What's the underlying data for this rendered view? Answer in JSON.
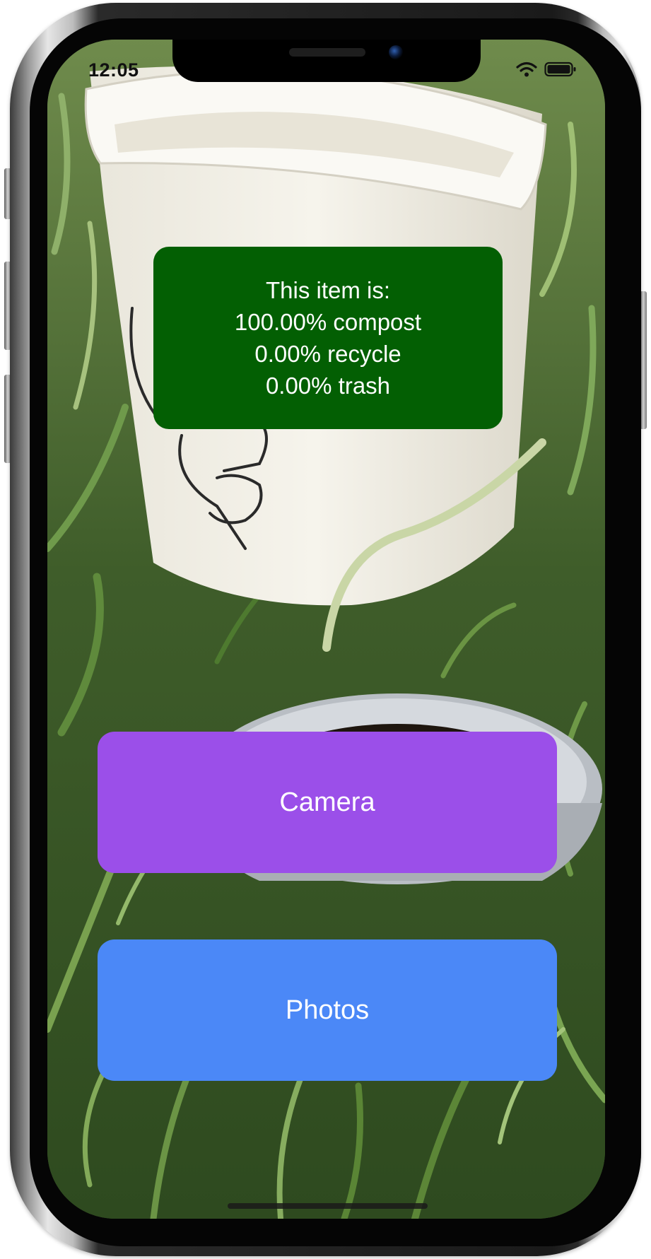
{
  "status_bar": {
    "time": "12:05",
    "icons": [
      "wifi-icon",
      "battery-icon"
    ]
  },
  "result": {
    "heading": "This item is:",
    "compost": "100.00% compost",
    "recycle": "0.00% recycle",
    "trash": "0.00% trash",
    "background_color": "#035f03"
  },
  "buttons": {
    "camera_label": "Camera",
    "photos_label": "Photos",
    "camera_color": "#9b4fe9",
    "photos_color": "#4b88f7"
  }
}
